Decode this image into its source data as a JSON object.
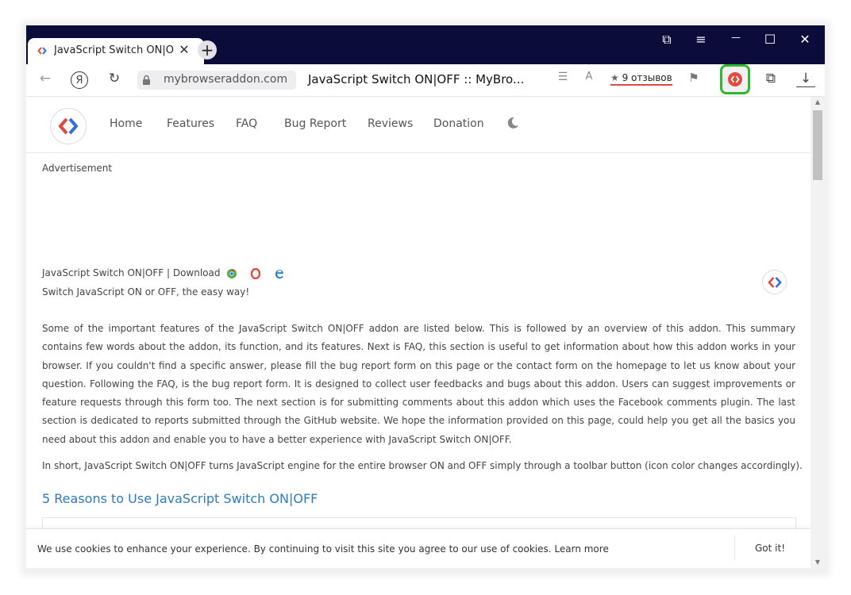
{
  "tab": {
    "title": "JavaScript Switch ON|OFF :: MyBrowserAddon",
    "close": "✕"
  },
  "newtab_label": "+",
  "window_controls": {
    "collections": "⧉",
    "menu": "≡",
    "minimize": "—",
    "maximize": "☐",
    "close": "✕"
  },
  "toolbar": {
    "back": "←",
    "yandex": "Я",
    "reload": "↻",
    "url": "mybrowseraddon.com",
    "page_title": "JavaScript Switch ON|OFF :: MyBro...",
    "reader": "☰",
    "translate": "A",
    "star": "★",
    "reviews": "9 отзывов",
    "bookmark": "⚑",
    "extensions": "⧉",
    "download": "↓"
  },
  "nav": [
    "Home",
    "Features",
    "FAQ",
    "Bug Report",
    "Reviews",
    "Donation"
  ],
  "advertisement": "Advertisement",
  "download_line": "JavaScript Switch ON|OFF  |  Download",
  "tagline": "Switch JavaScript ON or OFF, the easy way!",
  "paragraph1": "Some of the important features of the JavaScript Switch ON|OFF addon are listed below. This is followed by an overview of this addon. This summary contains few words about the addon, its function, and its features. Next is FAQ, this section is useful to get information about how this addon works in your browser. If you couldn't find a specific answer, please fill the bug report form on this page or the contact form on the homepage to let us know about your question. Following the FAQ, is the bug report form. It is designed to collect user feedbacks and bugs about this addon. Users can suggest improvements or feature requests through this form too. The next section is for submitting comments about this addon which uses the Facebook comments plugin. The last section is dedicated to reports submitted through the GitHub website. We hope the information provided on this page, could help you get all the basics you need about this addon and enable you to have a better experience with JavaScript Switch ON|OFF.",
  "paragraph2": "In short, JavaScript Switch ON|OFF turns JavaScript engine for the entire browser ON and OFF simply through a toolbar button (icon color changes accordingly).",
  "reasons_heading": "5 Reasons to Use JavaScript Switch ON|OFF",
  "cookie": {
    "text": "We use cookies to enhance your experience. By continuing to visit this site you agree to our use of cookies. Learn more",
    "button": "Got it!"
  },
  "scroll": {
    "up": "▲",
    "down": "▼"
  },
  "colors": {
    "titlebar": "#0b0c3a",
    "link": "#2b7bbf",
    "highlight": "#2eb82e",
    "logo_red": "#e2493f",
    "logo_blue": "#2f6fe0"
  }
}
